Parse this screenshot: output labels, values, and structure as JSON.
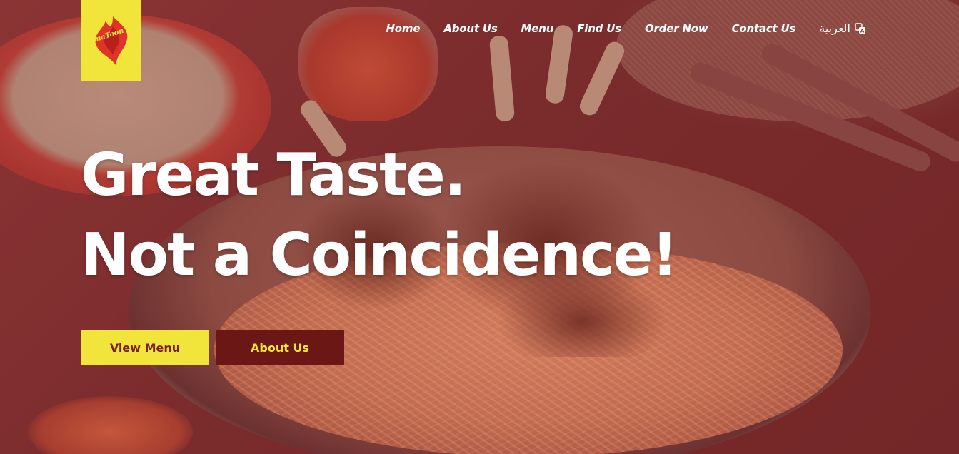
{
  "logo": {
    "text": "AlmaToon"
  },
  "nav": {
    "items": [
      "Home",
      "About Us",
      "Menu",
      "Find Us",
      "Order Now",
      "Contact Us"
    ],
    "language": "العربية",
    "language_icon": "translate-icon"
  },
  "hero": {
    "line1": "Great Taste.",
    "line2": "Not a Coincidence!",
    "primary_button": "View Menu",
    "secondary_button": "About Us"
  },
  "colors": {
    "accent_yellow": "#f1e53b",
    "brand_maroon": "#6b1715",
    "overlay": "#7a2a2a"
  }
}
